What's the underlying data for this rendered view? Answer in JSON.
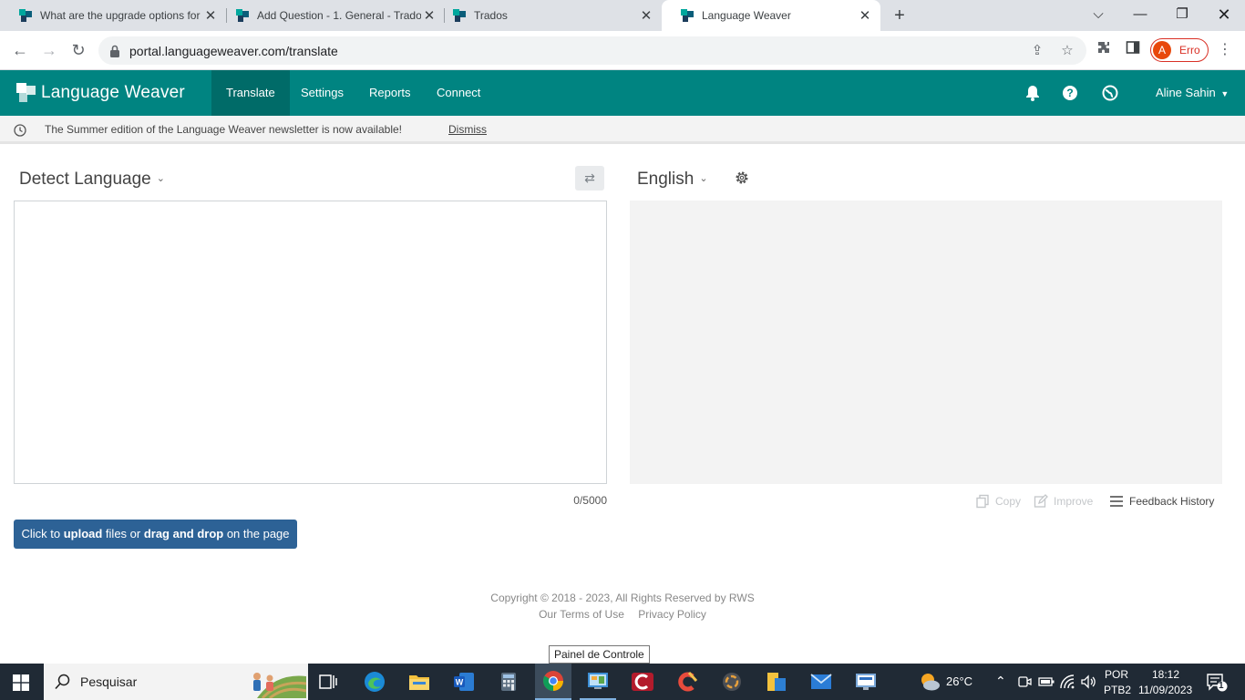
{
  "browser": {
    "tabs": [
      {
        "title": "What are the upgrade options for"
      },
      {
        "title": "Add Question - 1. General - Trados"
      },
      {
        "title": "Trados"
      },
      {
        "title": "Language Weaver"
      }
    ],
    "close_glyph": "✕",
    "new_tab_glyph": "+",
    "url": "portal.languageweaver.com/translate",
    "profile_initial": "A",
    "profile_status": "Erro"
  },
  "app": {
    "brand": "Language Weaver",
    "brand_color": "#008481",
    "nav": [
      {
        "label": "Translate"
      },
      {
        "label": "Settings"
      },
      {
        "label": "Reports"
      },
      {
        "label": "Connect"
      }
    ],
    "user_name": "Aline Sahin"
  },
  "notice": {
    "message": "The Summer edition of the Language Weaver newsletter is now available!",
    "dismiss": "Dismiss"
  },
  "translate": {
    "source_language": "Detect Language",
    "target_language": "English",
    "char_count": "0/5000",
    "actions": {
      "copy": "Copy",
      "improve": "Improve",
      "feedback_history": "Feedback History"
    },
    "upload": {
      "prefix": "Click to ",
      "upload": "upload",
      "middle": " files or ",
      "drag": "drag and drop",
      "suffix": " on the page"
    },
    "upload_color": "#2d6296"
  },
  "footer": {
    "copyright": "Copyright © 2018 - 2023, All Rights Reserved by RWS",
    "terms": "Our Terms of Use",
    "privacy": "Privacy Policy"
  },
  "tooltip": "Painel de Controle",
  "taskbar": {
    "search_placeholder": "Pesquisar",
    "weather": "26°C",
    "lang_line1": "POR",
    "lang_line2": "PTB2",
    "time": "18:12",
    "date": "11/09/2023",
    "notification_count": "1"
  }
}
